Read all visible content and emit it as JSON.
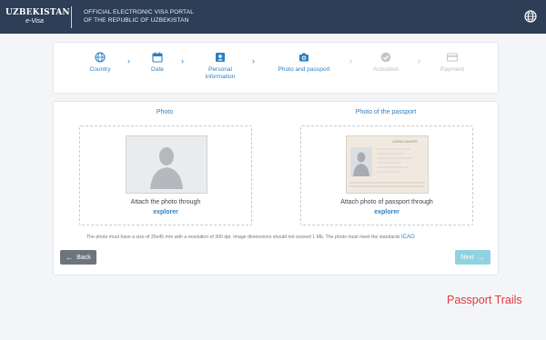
{
  "header": {
    "logo_text": "UZBEKISTAN",
    "logo_sub": "e-Visa",
    "title_line1": "OFFICIAL ELECTRONIC VISA PORTAL",
    "title_line2": "OF THE REPUBLIC OF UZBEKISTAN",
    "globe_icon": "globe-icon"
  },
  "steps": [
    {
      "label": "Country",
      "icon": "globe-icon",
      "state": "done"
    },
    {
      "label": "Date",
      "icon": "calendar-icon",
      "state": "done"
    },
    {
      "label": "Personal information",
      "icon": "id-card-icon",
      "state": "done"
    },
    {
      "label": "Photo and passport",
      "icon": "camera-icon",
      "state": "current"
    },
    {
      "label": "Activation",
      "icon": "check-circle-icon",
      "state": "upcoming"
    },
    {
      "label": "Payment",
      "icon": "card-icon",
      "state": "upcoming"
    }
  ],
  "upload": {
    "photo_title": "Photo",
    "photo_attach": "Attach the photo through",
    "photo_link": "explorer",
    "passport_title": "Photo of the passport",
    "passport_attach": "Attach photo of passport through",
    "passport_link": "explorer",
    "passport_sample_header": "LOREM COUNTRY"
  },
  "note": {
    "text": "The photo must have a size of 35x45 mm with a resolution of 300 dpi. Image dimensions should not exceed 1 Mb. The photo must meet the standards",
    "link": "ICAO"
  },
  "buttons": {
    "back": "Back",
    "next": "Next"
  },
  "watermark": "Passport Trails",
  "colors": {
    "header_bg": "#2d3e56",
    "accent": "#2f7fc1",
    "inactive": "#b9bec5",
    "back_btn": "#6c757d",
    "next_btn": "#8fd3e0",
    "watermark": "#e0393e"
  }
}
